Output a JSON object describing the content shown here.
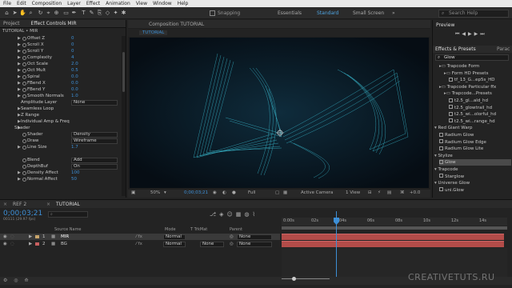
{
  "menu": [
    "File",
    "Edit",
    "Composition",
    "Layer",
    "Effect",
    "Animation",
    "View",
    "Window",
    "Help"
  ],
  "toolbar": {
    "snapping": "Snapping",
    "workspaces": [
      "Essentials",
      "Standard",
      "Small Screen"
    ],
    "active_workspace": "Standard",
    "search_placeholder": "Search Help"
  },
  "left_panel": {
    "tabs": [
      "Project",
      "Effect Controls MIR"
    ],
    "breadcrumb": "TUTORIAL • MIR",
    "props": [
      {
        "label": "Offset Z",
        "value": "0"
      },
      {
        "label": "Scroll X",
        "value": "0"
      },
      {
        "label": "Scroll Y",
        "value": "0"
      },
      {
        "label": "Complexity",
        "value": "4"
      },
      {
        "label": "Oct Scale",
        "value": "2.0"
      },
      {
        "label": "Oct Mult",
        "value": "0.5"
      },
      {
        "label": "Spiral",
        "value": "0.0"
      },
      {
        "label": "FBend X",
        "value": "0.0"
      },
      {
        "label": "FBend Y",
        "value": "0.0"
      },
      {
        "label": "Smooth Normals",
        "value": "1.0"
      }
    ],
    "amplitude_layer": {
      "label": "Amplitude Layer",
      "value": "None"
    },
    "sections": [
      "Seamless Loop",
      "Z Range",
      "Individual Amp & Freq",
      "Shader"
    ],
    "shader_props": [
      {
        "label": "Shader",
        "value": "Density"
      },
      {
        "label": "Draw",
        "value": "Wireframe"
      },
      {
        "label": "Line Size",
        "value": "1.7"
      },
      {
        "label": "Blend",
        "value": "Add"
      },
      {
        "label": "DepthBuf",
        "value": "On"
      },
      {
        "label": "Density Affect",
        "value": "100"
      },
      {
        "label": "Normal Affect",
        "value": "50"
      }
    ]
  },
  "comp_panel": {
    "tab": "Composition TUTORIAL",
    "subtab": "TUTORIAL",
    "zoom": "50%",
    "timecode": "0;00;03;21",
    "resolution": "Full",
    "camera": "Active Camera",
    "view": "1 View",
    "exposure": "+0.0"
  },
  "right_panel": {
    "preview": "Preview",
    "tabs": [
      "Effects & Presets",
      "Parac"
    ],
    "search_value": "Glow",
    "items": [
      {
        "text": "Trapcode Form",
        "indent": 1,
        "type": "folder"
      },
      {
        "text": "Form HD Presets",
        "indent": 2,
        "type": "folder"
      },
      {
        "text": "tf_13_G...ep5s_HD",
        "indent": 3,
        "type": "file"
      },
      {
        "text": "Trapcode Particular ffx",
        "indent": 1,
        "type": "folder"
      },
      {
        "text": "Trapcode...Presets",
        "indent": 2,
        "type": "folder"
      },
      {
        "text": "t2.5_gl...ald_hd",
        "indent": 3,
        "type": "file"
      },
      {
        "text": "t2.5_glowtrail_hd",
        "indent": 3,
        "type": "file"
      },
      {
        "text": "t2.5_wi...olorful_hd",
        "indent": 3,
        "type": "file"
      },
      {
        "text": "t2.5_wi...range_hd",
        "indent": 3,
        "type": "file"
      },
      {
        "text": "Red Giant Warp",
        "indent": 0,
        "type": "category"
      },
      {
        "text": "Radium Glow",
        "indent": 1,
        "type": "effect"
      },
      {
        "text": "Radium Glow Edge",
        "indent": 1,
        "type": "effect"
      },
      {
        "text": "Radium Glow Lite",
        "indent": 1,
        "type": "effect"
      },
      {
        "text": "Stylize",
        "indent": 0,
        "type": "category"
      },
      {
        "text": "Glow",
        "indent": 1,
        "type": "effect",
        "selected": true
      },
      {
        "text": "Trapcode",
        "indent": 0,
        "type": "category"
      },
      {
        "text": "Starglow",
        "indent": 1,
        "type": "effect"
      },
      {
        "text": "Universe Glow",
        "indent": 0,
        "type": "category"
      },
      {
        "text": "uni.Glow",
        "indent": 1,
        "type": "effect"
      }
    ]
  },
  "timeline": {
    "tabs": [
      "REF 2",
      "TUTORIAL"
    ],
    "timecode": "0;00;03;21",
    "fps": "00111 (29.97 fps)",
    "columns": [
      "Source Name",
      "Mode",
      "T TrkMat",
      "Parent"
    ],
    "layers": [
      {
        "num": "1",
        "name": "MIR",
        "mode": "Normal",
        "trkmat": "",
        "parent": "None",
        "color": "#c9a56a"
      },
      {
        "num": "2",
        "name": "BG",
        "mode": "Normal",
        "trkmat": "None",
        "parent": "None",
        "color": "#c95f5f"
      }
    ],
    "ruler": [
      "0:00s",
      "02s",
      "04s",
      "06s",
      "08s",
      "10s",
      "12s",
      "14s"
    ]
  },
  "watermark": "CREATIVETUTS.RU",
  "colors": {
    "accent": "#3d8fd6",
    "layer_bar": "#b34c49",
    "background": "#232323"
  }
}
